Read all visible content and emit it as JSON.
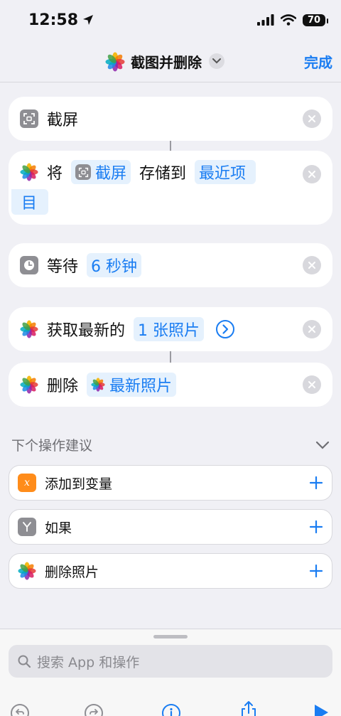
{
  "status": {
    "time": "12:58",
    "battery": "70"
  },
  "nav": {
    "title": "截图并删除",
    "done": "完成"
  },
  "actions": {
    "screenshot": {
      "label": "截屏"
    },
    "save": {
      "verb": "将",
      "token": "截屏",
      "mid": "存储到",
      "album_line1": "最近项",
      "album_line2": "目"
    },
    "wait": {
      "verb": "等待",
      "token": "6 秒钟"
    },
    "get": {
      "verb": "获取最新的",
      "token": "1 张照片"
    },
    "delete": {
      "verb": "删除",
      "token": "最新照片"
    }
  },
  "suggestions": {
    "header": "下个操作建议",
    "items": [
      {
        "label": "添加到变量",
        "icon": "variable-icon"
      },
      {
        "label": "如果",
        "icon": "if-icon"
      },
      {
        "label": "删除照片",
        "icon": "photos-icon"
      }
    ]
  },
  "search": {
    "placeholder": "搜索 App 和操作"
  },
  "colors": {
    "accent": "#1a7df2",
    "variable": "#ff8c1a",
    "gray": "#8e8e93"
  }
}
